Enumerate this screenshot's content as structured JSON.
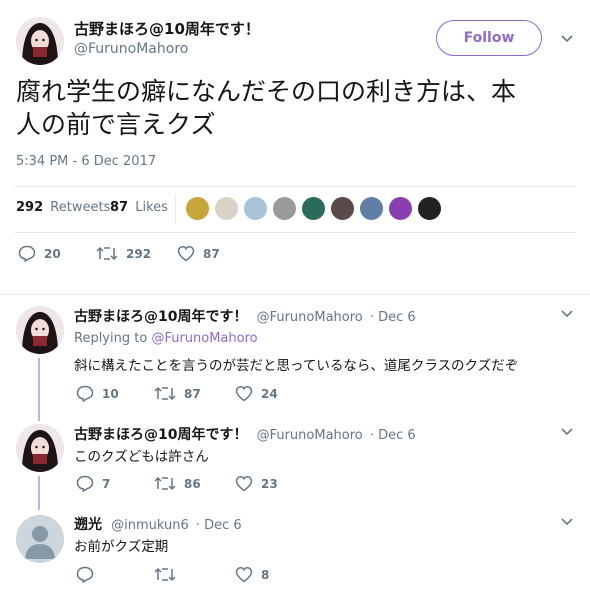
{
  "main": {
    "author_name": "古野まほろ@10周年です！",
    "author_handle": "@FurunoMahoro",
    "follow_label": "Follow",
    "text_line1": "腐れ学生の癖になんだその口の利き方は、本",
    "text_line2": "人の前で言えクズ",
    "timestamp": "5:34 PM - 6 Dec 2017",
    "retweets_count": "292",
    "retweets_label": "Retweets",
    "likes_count": "87",
    "likes_label": "Likes",
    "actions": {
      "reply": "20",
      "retweet": "292",
      "like": "87"
    }
  },
  "replies": [
    {
      "name": "古野まほろ@10周年です！",
      "handle": "@FurunoMahoro",
      "date": "· Dec 6",
      "replying_label": "Replying to ",
      "replying_to": "@FurunoMahoro",
      "text": "斜に構えたことを言うのが芸だと思っているなら、道尾クラスのクズだぞ",
      "reply": "10",
      "retweet": "87",
      "like": "24"
    },
    {
      "name": "古野まほろ@10周年です！",
      "handle": "@FurunoMahoro",
      "date": "· Dec 6",
      "text": "このクズどもは許さん",
      "reply": "7",
      "retweet": "86",
      "like": "23"
    },
    {
      "name": "遡光",
      "handle": "@inmukun6",
      "date": "· Dec 6",
      "text": "お前がクズ定期",
      "reply": "",
      "retweet": "",
      "like": "8"
    }
  ],
  "colors": {
    "accent": "#8e6ad0",
    "thread": "#c6b1ec",
    "muted": "#657786",
    "divider": "#e6ecf0"
  },
  "icons": [
    "chevron-down-icon",
    "reply-icon",
    "retweet-icon",
    "heart-icon",
    "default-avatar-icon"
  ]
}
